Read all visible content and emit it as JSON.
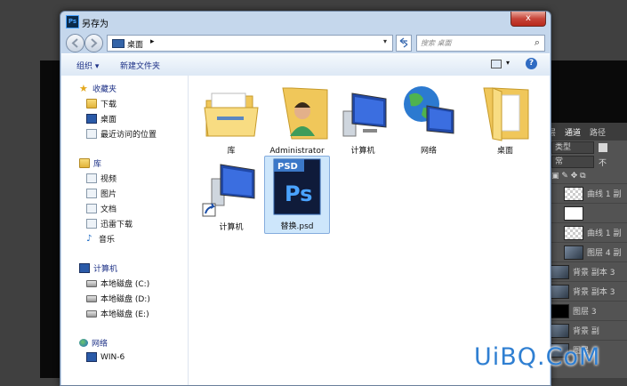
{
  "dialog": {
    "title": "另存为",
    "app_icon_text": "Ps",
    "close_label": "x"
  },
  "nav": {
    "back_icon": "back-arrow-icon",
    "forward_icon": "forward-arrow-icon",
    "address_label": "桌面",
    "address_arrow": "▸",
    "address_dropdown": "▾",
    "refresh_icon": "refresh-icon",
    "search_placeholder": "搜索 桌面"
  },
  "toolbar": {
    "organize_label": "组织 ▾",
    "new_folder_label": "新建文件夹",
    "view_dropdown": "▾",
    "help_label": "?"
  },
  "sidebar": {
    "favorites": {
      "label": "收藏夹",
      "items": [
        {
          "label": "下载"
        },
        {
          "label": "桌面"
        },
        {
          "label": "最近访问的位置"
        }
      ]
    },
    "libraries": {
      "label": "库",
      "items": [
        {
          "label": "视频"
        },
        {
          "label": "图片"
        },
        {
          "label": "文档"
        },
        {
          "label": "迅雷下载"
        },
        {
          "label": "音乐"
        }
      ]
    },
    "computer": {
      "label": "计算机",
      "items": [
        {
          "label": "本地磁盘 (C:)"
        },
        {
          "label": "本地磁盘 (D:)"
        },
        {
          "label": "本地磁盘 (E:)"
        }
      ]
    },
    "network": {
      "label": "网络",
      "items": [
        {
          "label": "WIN-6"
        }
      ]
    }
  },
  "files": [
    {
      "label": "库",
      "icon": "library-folder-icon"
    },
    {
      "label": "Administrator",
      "icon": "user-folder-icon"
    },
    {
      "label": "计算机",
      "icon": "computer-icon"
    },
    {
      "label": "网络",
      "icon": "network-icon"
    },
    {
      "label": "桌面",
      "icon": "folder-icon"
    },
    {
      "label": "计算机",
      "icon": "computer-shortcut-icon"
    },
    {
      "label": "替换.psd",
      "icon": "psd-file-icon",
      "badge": "PSD",
      "logo": "Ps",
      "selected": true
    }
  ],
  "ps_panel": {
    "tabs": [
      "层",
      "通道",
      "路径"
    ],
    "filter_label": "类型",
    "blend_label": "常",
    "opacity_label": "不",
    "layers": [
      {
        "label": "曲线 1 副"
      },
      {
        "label": ""
      },
      {
        "label": "曲线 1 副"
      },
      {
        "label": "图层 4 副"
      },
      {
        "label": "背景 副本 3"
      },
      {
        "label": "背景 副本 3"
      },
      {
        "label": "图层 3"
      },
      {
        "label": "背景 副"
      },
      {
        "label": "图层"
      }
    ]
  },
  "watermark": "UiBQ.CoM"
}
